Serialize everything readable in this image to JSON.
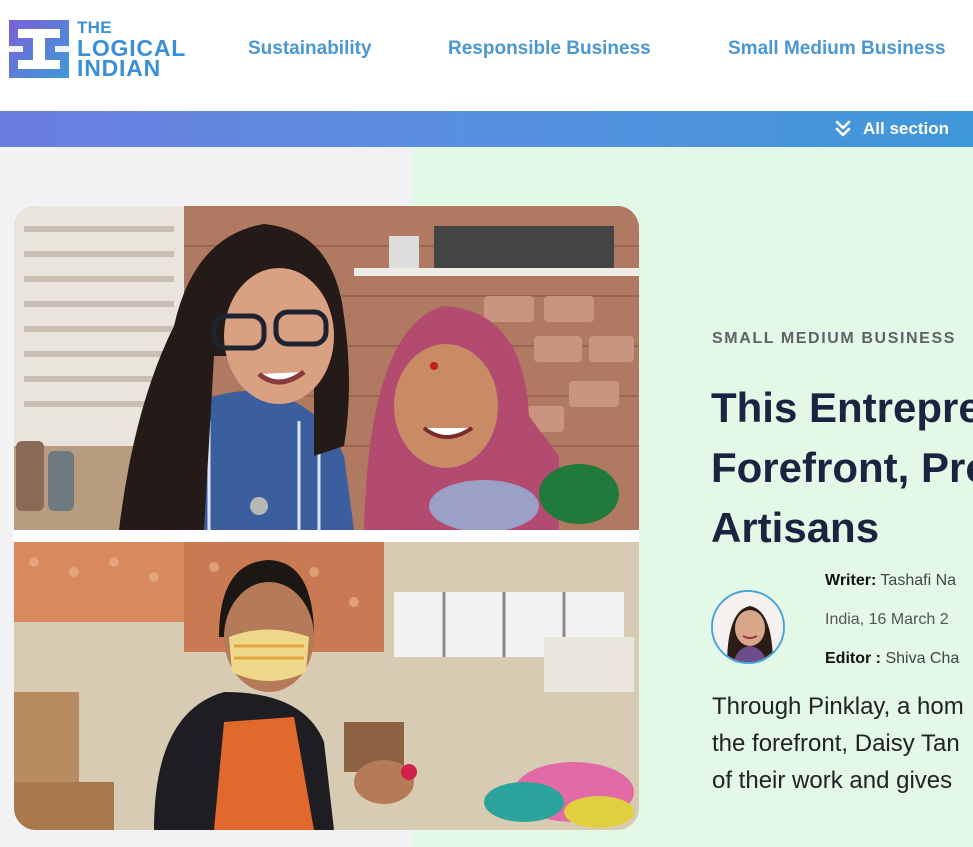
{
  "brand": {
    "line1": "THE",
    "line2": "LOGICAL",
    "line3": "INDIAN"
  },
  "nav": {
    "items": [
      {
        "label": "Sustainability"
      },
      {
        "label": "Responsible Business"
      },
      {
        "label": "Small Medium Business"
      }
    ]
  },
  "section_bar": {
    "label": "All section",
    "icon": "double-chevron-down-icon"
  },
  "article": {
    "category": "SMALL MEDIUM BUSINESS",
    "headline_lines": [
      "This Entrepre",
      "Forefront, Pro",
      "Artisans"
    ],
    "writer_label": "Writer:",
    "writer_name": "Tashafi Na",
    "location_date": "India,  16 March 2",
    "editor_label": "Editor :",
    "editor_name": "Shiva Cha",
    "summary_lines": [
      "Through Pinklay, a hom",
      "the forefront, Daisy Tan",
      "of their work and gives"
    ]
  },
  "colors": {
    "brand_blue": "#3b8fd6",
    "nav_blue": "#4a97d2",
    "headline": "#1c2340",
    "panel_green": "#e3f8e6"
  }
}
